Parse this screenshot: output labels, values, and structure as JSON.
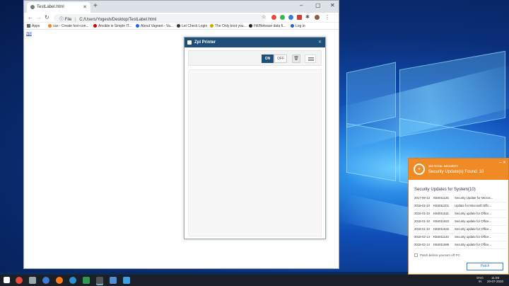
{
  "browser": {
    "tab_title": "TestLabel.html",
    "url_scheme": "File",
    "url": "C:/Users/Yogesh/Desktop/TestLabel.html",
    "bookmarks": [
      "Apps",
      "css - Create hori-con...",
      "Ansible is Simple IT...",
      "About Vagrant - Va...",
      "Let Check Login",
      "The Only knot you...",
      "Fill/Release data fi...",
      "Log in"
    ],
    "page_link": "zpl"
  },
  "zpl_printer": {
    "title": "Zpl Printer",
    "on_label": "ON",
    "off_label": "OFF"
  },
  "security_popup": {
    "brand": "360 TOTAL SECURITY",
    "found": "Security Update(s) Found: 10",
    "list_title": "Security Updates for System(10)",
    "rows": [
      {
        "date": "2017-09-13",
        "kb": "KB4011126",
        "desc": "Security Update for Micros..."
      },
      {
        "date": "2018-01-10",
        "kb": "KB4011201",
        "desc": "Update for Microsoft Offic..."
      },
      {
        "date": "2018-01-10",
        "kb": "KB4011611",
        "desc": "Security update for Office..."
      },
      {
        "date": "2018-01-10",
        "kb": "KB4011622",
        "desc": "Security update for Office..."
      },
      {
        "date": "2018-01-10",
        "kb": "KB4011632",
        "desc": "Security update for Office..."
      },
      {
        "date": "2018-02-14",
        "kb": "KB4011143",
        "desc": "Security update for Office..."
      },
      {
        "date": "2018-02-14",
        "kb": "KB4011686",
        "desc": "Security update for Office..."
      }
    ],
    "checkbox_label": "Patch before you turn off PC",
    "patch_button": "Patch"
  },
  "taskbar": {
    "lang": "ENG",
    "region": "IN",
    "time": "11:28",
    "date": "20-07-2020"
  },
  "colors": {
    "accent": "#1f4e79",
    "security_orange": "#f08a24",
    "link": "#1a3fd6"
  }
}
